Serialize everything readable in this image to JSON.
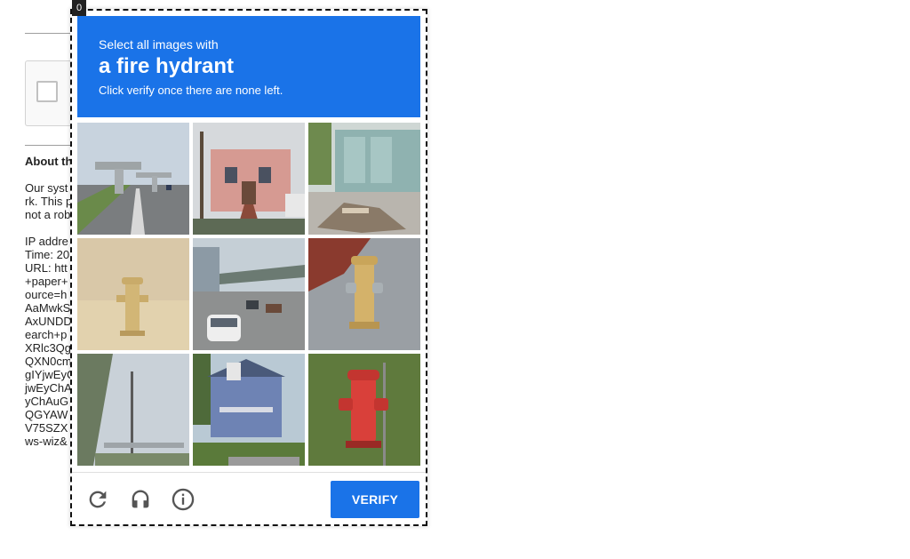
{
  "background": {
    "about_heading": "About th",
    "paragraph1": [
      "Our syst",
      "rk. This p",
      "not a rob"
    ],
    "paragraph2": [
      "IP addre",
      "Time: 20",
      "URL: htt",
      "+paper+",
      "ource=h",
      "AaMwkS",
      "AxUNDD",
      "earch+p",
      "XRlc3Qg",
      "QXN0cm",
      "gIYjwEyC",
      "jwEyChA",
      "yChAuG",
      "QGYAW",
      "V75SZX",
      "ws-wiz&"
    ]
  },
  "challenge": {
    "badge": "0",
    "instruction": "Select all images with",
    "target": "a fire hydrant",
    "subtext": "Click verify once there are none left.",
    "tiles": [
      {
        "subject": "highway overpass"
      },
      {
        "subject": "pink house"
      },
      {
        "subject": "storefront with debris"
      },
      {
        "subject": "fire hydrant"
      },
      {
        "subject": "street with elevated road"
      },
      {
        "subject": "fire hydrant"
      },
      {
        "subject": "overpass"
      },
      {
        "subject": "blue house"
      },
      {
        "subject": "fire hydrant"
      }
    ],
    "verify_label": "VERIFY",
    "controls": {
      "reload": "reload-icon",
      "audio": "headphones-icon",
      "info": "info-icon"
    },
    "accent_color": "#1a73e8"
  }
}
